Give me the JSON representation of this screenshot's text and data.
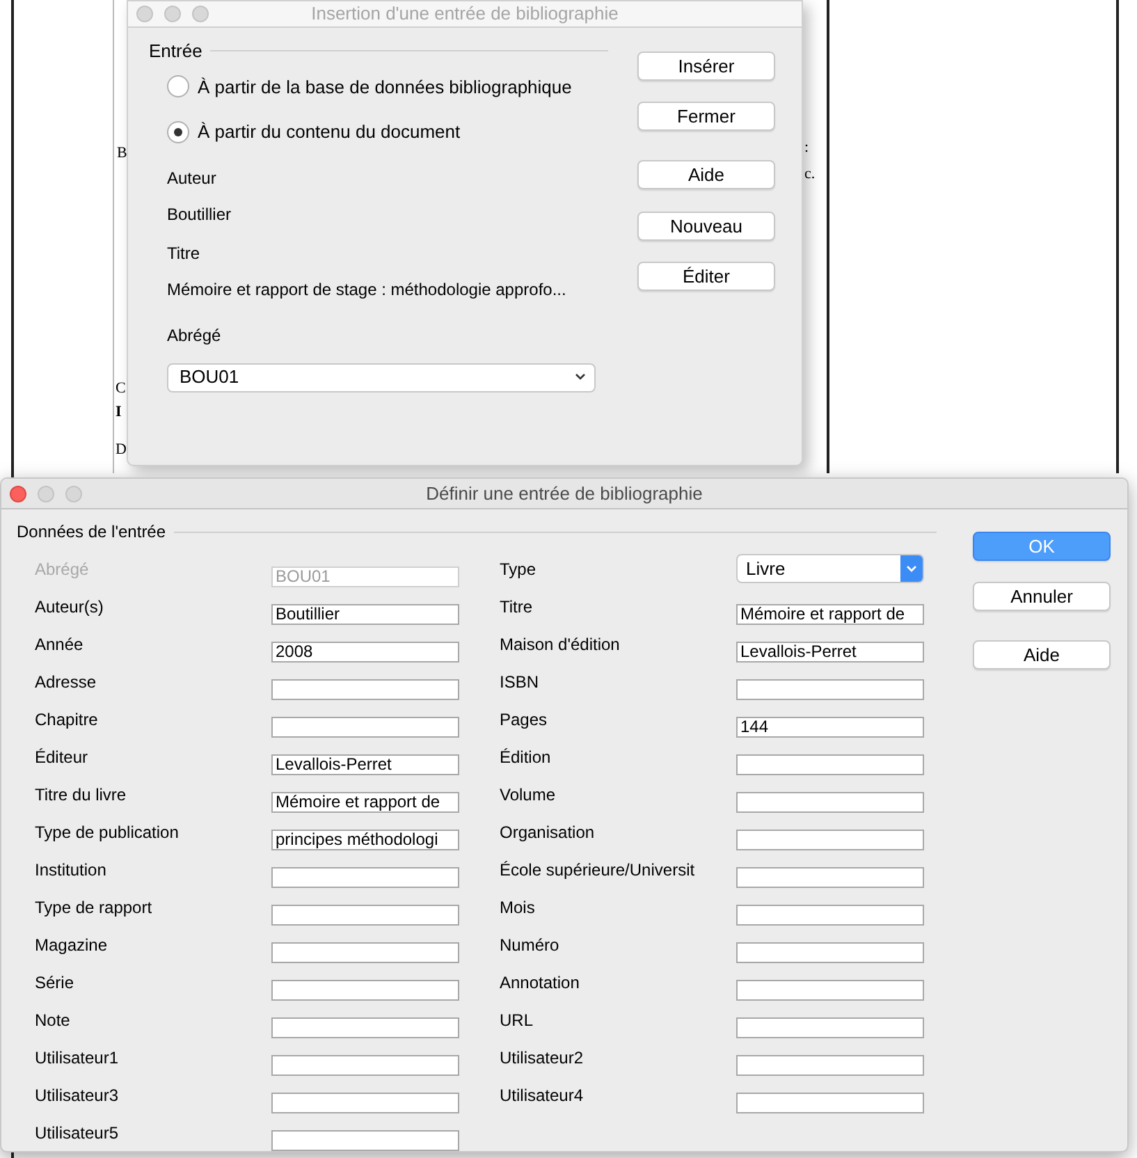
{
  "document_fragments": [
    {
      "text": "B",
      "bold": false
    },
    {
      "text": ":",
      "bold": false
    },
    {
      "text": "c.",
      "bold": false
    },
    {
      "text": "C",
      "bold": false
    },
    {
      "text": "I",
      "bold": true
    },
    {
      "text": "D",
      "bold": false
    }
  ],
  "insert_dialog": {
    "title": "Insertion d'une entrée de bibliographie",
    "section": "Entrée",
    "sources": [
      {
        "label": "À partir de la base de données bibliographique",
        "selected": false
      },
      {
        "label": "À partir du contenu du document",
        "selected": true
      }
    ],
    "author_label": "Auteur",
    "author": "Boutillier",
    "title_label": "Titre",
    "title_value": "Mémoire et rapport de stage : méthodologie approfo...",
    "short_label": "Abrégé",
    "short_value": "BOU01",
    "buttons": [
      "Insérer",
      "Fermer",
      "Aide",
      "Nouveau",
      "Éditer"
    ]
  },
  "define_dialog": {
    "title": "Définir une entrée de bibliographie",
    "section": "Données de l'entrée",
    "left_fields": [
      {
        "label": "Abrégé",
        "kind": "text",
        "value": "BOU01",
        "disabled": true
      },
      {
        "label": "Auteur(s)",
        "kind": "text",
        "value": "Boutillier",
        "disabled": false
      },
      {
        "label": "Année",
        "kind": "text",
        "value": "2008",
        "disabled": false
      },
      {
        "label": "Adresse",
        "kind": "text",
        "disabled": false
      },
      {
        "label": "Chapitre",
        "kind": "text",
        "disabled": false
      },
      {
        "label": "Éditeur",
        "kind": "text",
        "value": "Levallois-Perret",
        "disabled": false
      },
      {
        "label": "Titre du livre",
        "kind": "text",
        "value": "Mémoire et rapport de",
        "disabled": false
      },
      {
        "label": "Type de publication",
        "kind": "text",
        "value": "principes méthodologi",
        "disabled": false
      },
      {
        "label": "Institution",
        "kind": "text",
        "disabled": false
      },
      {
        "label": "Type de rapport",
        "kind": "text",
        "disabled": false
      },
      {
        "label": "Magazine",
        "kind": "text",
        "disabled": false
      },
      {
        "label": "Série",
        "kind": "text",
        "disabled": false
      },
      {
        "label": "Note",
        "kind": "text",
        "disabled": false
      },
      {
        "label": "Utilisateur1",
        "kind": "text",
        "disabled": false
      },
      {
        "label": "Utilisateur3",
        "kind": "text",
        "disabled": false
      },
      {
        "label": "Utilisateur5",
        "kind": "text",
        "disabled": false
      }
    ],
    "right_fields": [
      {
        "label": "Type",
        "kind": "select",
        "value": "Livre"
      },
      {
        "label": "Titre",
        "kind": "text",
        "value": "Mémoire et rapport de",
        "disabled": false
      },
      {
        "label": "Maison d'édition",
        "kind": "text",
        "value": "Levallois-Perret",
        "disabled": false
      },
      {
        "label": "ISBN",
        "kind": "text",
        "disabled": false
      },
      {
        "label": "Pages",
        "kind": "text",
        "value": "144",
        "disabled": false
      },
      {
        "label": "Édition",
        "kind": "text",
        "disabled": false
      },
      {
        "label": "Volume",
        "kind": "text",
        "disabled": false
      },
      {
        "label": "Organisation",
        "kind": "text",
        "disabled": false
      },
      {
        "label": "École supérieure/Universit",
        "kind": "text",
        "disabled": false
      },
      {
        "label": "Mois",
        "kind": "text",
        "disabled": false
      },
      {
        "label": "Numéro",
        "kind": "text",
        "disabled": false
      },
      {
        "label": "Annotation",
        "kind": "text",
        "disabled": false
      },
      {
        "label": "URL",
        "kind": "text",
        "disabled": false
      },
      {
        "label": "Utilisateur2",
        "kind": "text",
        "disabled": false
      },
      {
        "label": "Utilisateur4",
        "kind": "text",
        "disabled": false
      }
    ],
    "buttons": [
      {
        "label": "OK",
        "kind": "default"
      },
      {
        "label": "Annuler",
        "kind": "normal"
      },
      {
        "label": "Aide",
        "kind": "normal"
      }
    ]
  }
}
